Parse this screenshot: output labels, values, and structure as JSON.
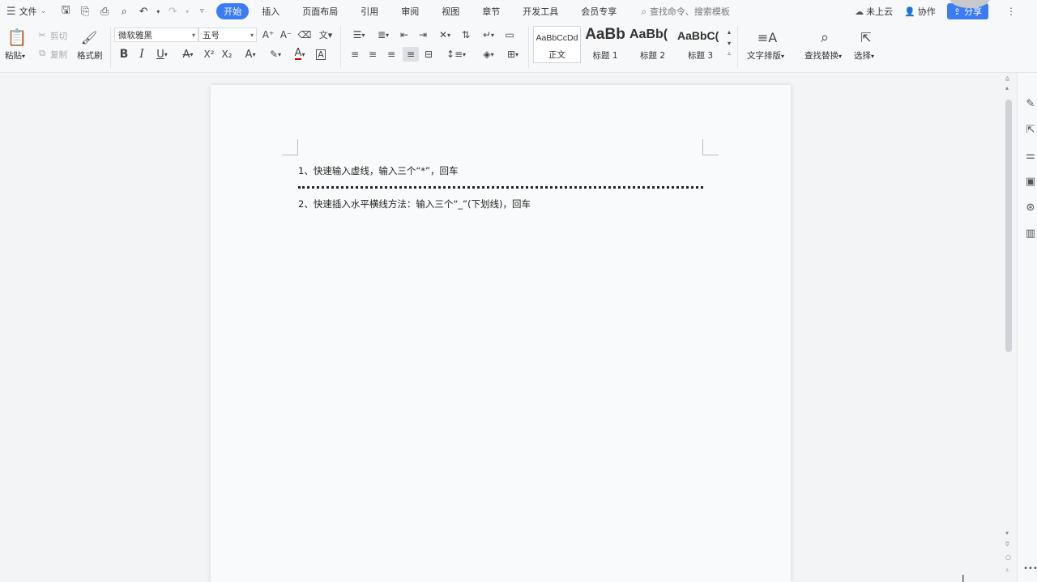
{
  "menubar": {
    "file_label": "文件",
    "tabs": [
      "开始",
      "插入",
      "页面布局",
      "引用",
      "审阅",
      "视图",
      "章节",
      "开发工具",
      "会员专享"
    ],
    "search_placeholder": "查找命令、搜索模板",
    "cloud_label": "未上云",
    "collab_label": "协作",
    "share_label": "分享"
  },
  "ribbon": {
    "paste_label": "粘贴",
    "cut_label": "剪切",
    "copy_label": "复制",
    "format_painter_label": "格式刷",
    "font_name": "微软雅黑",
    "font_size": "五号",
    "styles": [
      {
        "sample": "AaBbCcDd",
        "name": "正文"
      },
      {
        "sample": "AaBb",
        "name": "标题 1"
      },
      {
        "sample": "AaBb(",
        "name": "标题 2"
      },
      {
        "sample": "AaBbC(",
        "name": "标题 3"
      }
    ],
    "text_layout_label": "文字排版",
    "find_replace_label": "查找替换",
    "select_label": "选择"
  },
  "document": {
    "line1": "1、快速输入虚线，输入三个“*”，回车",
    "line2": "2、快速插入水平横线方法：输入三个“_”(下划线)，回车"
  },
  "colors": {
    "accent": "#3b7cf5"
  }
}
